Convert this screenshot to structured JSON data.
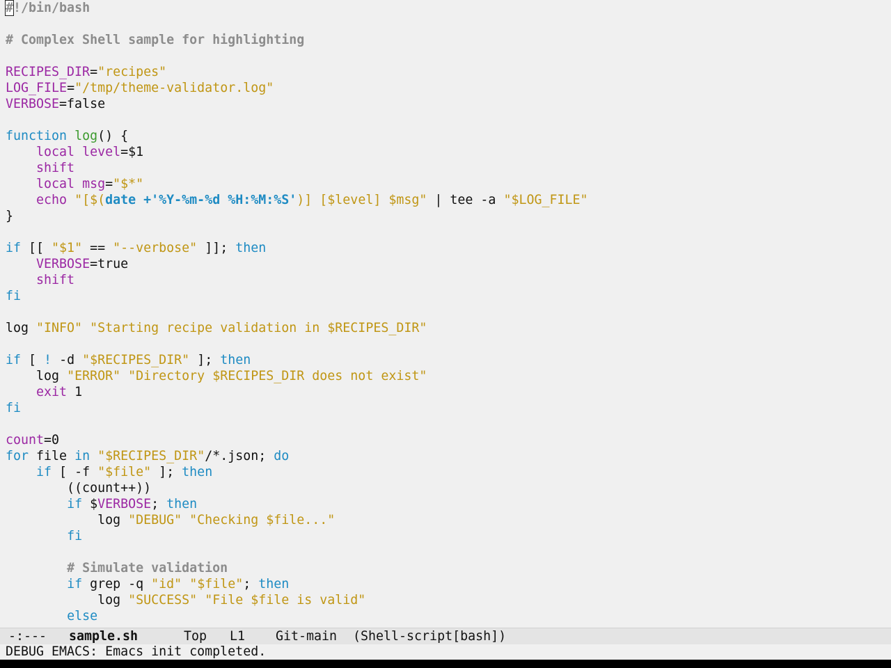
{
  "window": {
    "background": "#f0f0f0",
    "frame_border_color": "#000000"
  },
  "syntax_colors": {
    "comment": "#8c8c8c",
    "keyword": "#1e8bc3",
    "builtin": "#9b27a3",
    "variable": "#9b27a3",
    "function": "#3c9a2e",
    "string": "#c09614",
    "plain": "#111111"
  },
  "buffer": {
    "cursor": {
      "line": 1,
      "column": 1,
      "char": "#"
    },
    "lines": [
      [
        [
          "comment",
          "#!/bin/bash"
        ]
      ],
      [],
      [
        [
          "comment",
          "# Complex Shell sample for highlighting"
        ]
      ],
      [],
      [
        [
          "variable",
          "RECIPES_DIR"
        ],
        [
          "plain",
          "="
        ],
        [
          "string",
          "\"recipes\""
        ]
      ],
      [
        [
          "variable",
          "LOG_FILE"
        ],
        [
          "plain",
          "="
        ],
        [
          "string",
          "\"/tmp/theme-validator.log\""
        ]
      ],
      [
        [
          "variable",
          "VERBOSE"
        ],
        [
          "plain",
          "=false"
        ]
      ],
      [],
      [
        [
          "keyword",
          "function"
        ],
        [
          "plain",
          " "
        ],
        [
          "function",
          "log"
        ],
        [
          "plain",
          "() {"
        ]
      ],
      [
        [
          "plain",
          "    "
        ],
        [
          "builtin",
          "local"
        ],
        [
          "plain",
          " "
        ],
        [
          "variable",
          "level"
        ],
        [
          "plain",
          "=$1"
        ]
      ],
      [
        [
          "plain",
          "    "
        ],
        [
          "builtin",
          "shift"
        ]
      ],
      [
        [
          "plain",
          "    "
        ],
        [
          "builtin",
          "local"
        ],
        [
          "plain",
          " "
        ],
        [
          "variable",
          "msg"
        ],
        [
          "plain",
          "="
        ],
        [
          "string",
          "\"$*\""
        ]
      ],
      [
        [
          "plain",
          "    "
        ],
        [
          "builtin",
          "echo"
        ],
        [
          "plain",
          " "
        ],
        [
          "string",
          "\"[$("
        ],
        [
          "date",
          "date +'%Y-%m-%d %H:%M:%S'"
        ],
        [
          "string",
          ")] [$level] $msg\""
        ],
        [
          "plain",
          " | tee -a "
        ],
        [
          "string",
          "\"$LOG_FILE\""
        ]
      ],
      [
        [
          "plain",
          "}"
        ]
      ],
      [],
      [
        [
          "keyword",
          "if"
        ],
        [
          "plain",
          " [[ "
        ],
        [
          "string",
          "\"$1\""
        ],
        [
          "plain",
          " == "
        ],
        [
          "string",
          "\"--verbose\""
        ],
        [
          "plain",
          " ]]; "
        ],
        [
          "keyword",
          "then"
        ]
      ],
      [
        [
          "plain",
          "    "
        ],
        [
          "variable",
          "VERBOSE"
        ],
        [
          "plain",
          "=true"
        ]
      ],
      [
        [
          "plain",
          "    "
        ],
        [
          "builtin",
          "shift"
        ]
      ],
      [
        [
          "keyword",
          "fi"
        ]
      ],
      [],
      [
        [
          "plain",
          "log "
        ],
        [
          "string",
          "\"INFO\""
        ],
        [
          "plain",
          " "
        ],
        [
          "string",
          "\"Starting recipe validation in $RECIPES_DIR\""
        ]
      ],
      [],
      [
        [
          "keyword",
          "if"
        ],
        [
          "plain",
          " [ "
        ],
        [
          "keyword",
          "!"
        ],
        [
          "plain",
          " -d "
        ],
        [
          "string",
          "\"$RECIPES_DIR\""
        ],
        [
          "plain",
          " ]; "
        ],
        [
          "keyword",
          "then"
        ]
      ],
      [
        [
          "plain",
          "    log "
        ],
        [
          "string",
          "\"ERROR\""
        ],
        [
          "plain",
          " "
        ],
        [
          "string",
          "\"Directory $RECIPES_DIR does not exist\""
        ]
      ],
      [
        [
          "plain",
          "    "
        ],
        [
          "builtin",
          "exit"
        ],
        [
          "plain",
          " 1"
        ]
      ],
      [
        [
          "keyword",
          "fi"
        ]
      ],
      [],
      [
        [
          "variable",
          "count"
        ],
        [
          "plain",
          "=0"
        ]
      ],
      [
        [
          "keyword",
          "for"
        ],
        [
          "plain",
          " file "
        ],
        [
          "keyword",
          "in"
        ],
        [
          "plain",
          " "
        ],
        [
          "string",
          "\"$RECIPES_DIR\""
        ],
        [
          "plain",
          "/*.json; "
        ],
        [
          "keyword",
          "do"
        ]
      ],
      [
        [
          "plain",
          "    "
        ],
        [
          "keyword",
          "if"
        ],
        [
          "plain",
          " [ -f "
        ],
        [
          "string",
          "\"$file\""
        ],
        [
          "plain",
          " ]; "
        ],
        [
          "keyword",
          "then"
        ]
      ],
      [
        [
          "plain",
          "        ((count++))"
        ]
      ],
      [
        [
          "plain",
          "        "
        ],
        [
          "keyword",
          "if"
        ],
        [
          "plain",
          " $"
        ],
        [
          "variable",
          "VERBOSE"
        ],
        [
          "plain",
          "; "
        ],
        [
          "keyword",
          "then"
        ]
      ],
      [
        [
          "plain",
          "            log "
        ],
        [
          "string",
          "\"DEBUG\""
        ],
        [
          "plain",
          " "
        ],
        [
          "string",
          "\"Checking $file...\""
        ]
      ],
      [
        [
          "plain",
          "        "
        ],
        [
          "keyword",
          "fi"
        ]
      ],
      [],
      [
        [
          "plain",
          "        "
        ],
        [
          "comment",
          "# Simulate validation"
        ]
      ],
      [
        [
          "plain",
          "        "
        ],
        [
          "keyword",
          "if"
        ],
        [
          "plain",
          " grep -q "
        ],
        [
          "string",
          "\"id\""
        ],
        [
          "plain",
          " "
        ],
        [
          "string",
          "\"$file\""
        ],
        [
          "plain",
          "; "
        ],
        [
          "keyword",
          "then"
        ]
      ],
      [
        [
          "plain",
          "            log "
        ],
        [
          "string",
          "\"SUCCESS\""
        ],
        [
          "plain",
          " "
        ],
        [
          "string",
          "\"File $file is valid\""
        ]
      ],
      [
        [
          "plain",
          "        "
        ],
        [
          "keyword",
          "else"
        ]
      ]
    ]
  },
  "mode_line": {
    "status": "-:---",
    "buffer_name": "sample.sh",
    "position": "Top",
    "line": "L1",
    "vc": "Git-main",
    "major_mode": "(Shell-script[bash])"
  },
  "echo_area": {
    "message": "DEBUG EMACS: Emacs init completed."
  }
}
